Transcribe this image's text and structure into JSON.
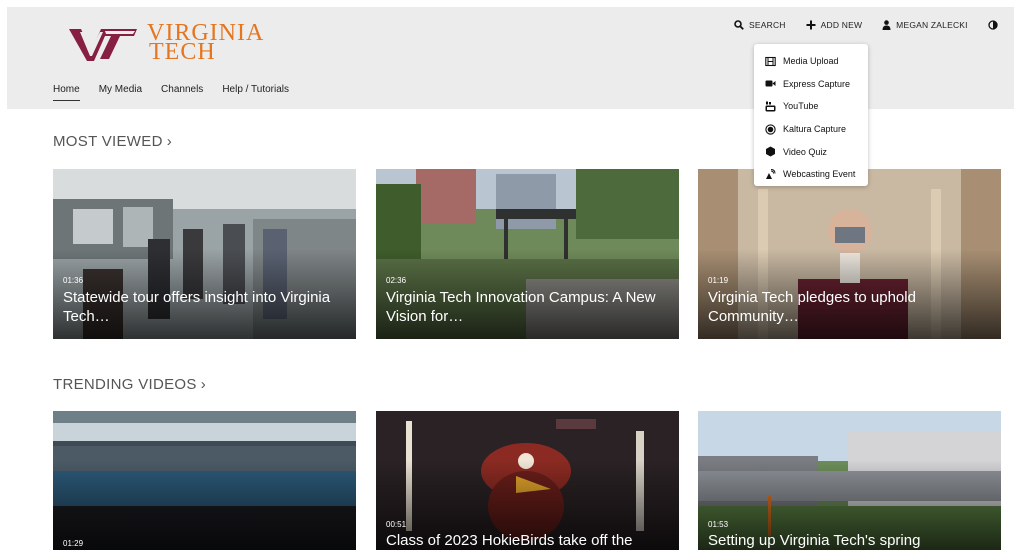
{
  "brand": {
    "line1": "VIRGINIA",
    "line2": "TECH",
    "color": "#e5751f",
    "maroon": "#861f41"
  },
  "nav": [
    "Home",
    "My Media",
    "Channels",
    "Help / Tutorials"
  ],
  "topbar": {
    "search": "SEARCH",
    "add_new": "ADD NEW",
    "user": "MEGAN ZALECKI"
  },
  "dropdown": [
    {
      "label": "Media Upload",
      "icon": "film-icon"
    },
    {
      "label": "Express Capture",
      "icon": "video-camera-icon"
    },
    {
      "label": "YouTube",
      "icon": "youtube-icon"
    },
    {
      "label": "Kaltura Capture",
      "icon": "record-icon"
    },
    {
      "label": "Video Quiz",
      "icon": "quiz-icon"
    },
    {
      "label": "Webcasting Event",
      "icon": "broadcast-icon"
    }
  ],
  "sections": {
    "most_viewed": "MOST VIEWED",
    "trending": "TRENDING VIDEOS",
    "chevron": "›"
  },
  "most_viewed": [
    {
      "duration": "01:36",
      "title": "Statewide tour offers insight into Virginia Tech…"
    },
    {
      "duration": "02:36",
      "title": "Virginia Tech Innovation Campus: A New Vision for…"
    },
    {
      "duration": "01:19",
      "title": "Virginia Tech pledges to uphold Community…"
    }
  ],
  "trending": [
    {
      "duration": "01:29",
      "title": ""
    },
    {
      "duration": "00:51",
      "title": "Class of 2023 HokieBirds take off the"
    },
    {
      "duration": "01:53",
      "title": "Setting up Virginia Tech's spring"
    }
  ]
}
